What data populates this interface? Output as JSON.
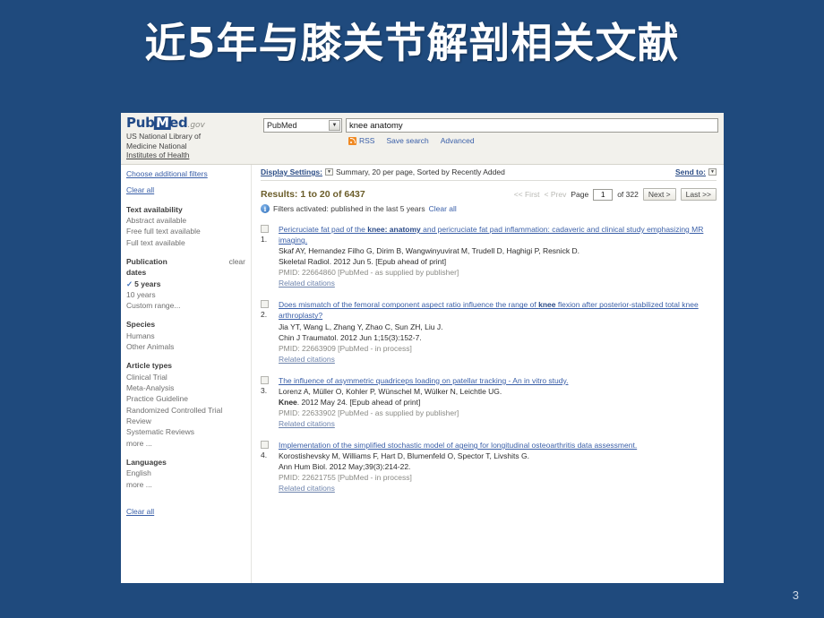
{
  "slide": {
    "title": "近5年与膝关节解剖相关文献",
    "number": "3",
    "background_color": "#1f4a7d"
  },
  "pubmed": {
    "logo": {
      "part1": "Pub",
      "part2": "M",
      "part3": "ed",
      "suffix": ".gov"
    },
    "agency_line1": "US National Library of",
    "agency_line2": "Medicine National",
    "agency_line3": "Institutes of Health",
    "choose_filters_link": "Choose additional filters",
    "search": {
      "database": "PubMed",
      "query": "knee anatomy",
      "rss_label": "RSS",
      "save_search_label": "Save search",
      "advanced_label": "Advanced"
    },
    "sidebar": {
      "clear_all_top": "Clear all",
      "clear_all_bottom": "Clear all",
      "groups": [
        {
          "heading": "Text availability",
          "clear_label": "",
          "items": [
            {
              "label": "Abstract available",
              "selected": false
            },
            {
              "label": "Free full text available",
              "selected": false
            },
            {
              "label": "Full text available",
              "selected": false
            }
          ]
        },
        {
          "heading": "Publication dates",
          "clear_label": "clear",
          "items": [
            {
              "label": "5 years",
              "selected": true
            },
            {
              "label": "10 years",
              "selected": false
            },
            {
              "label": "Custom range...",
              "selected": false
            }
          ]
        },
        {
          "heading": "Species",
          "clear_label": "",
          "items": [
            {
              "label": "Humans",
              "selected": false
            },
            {
              "label": "Other Animals",
              "selected": false
            }
          ]
        },
        {
          "heading": "Article types",
          "clear_label": "",
          "items": [
            {
              "label": "Clinical Trial",
              "selected": false
            },
            {
              "label": "Meta-Analysis",
              "selected": false
            },
            {
              "label": "Practice Guideline",
              "selected": false
            },
            {
              "label": "Randomized Controlled Trial",
              "selected": false
            },
            {
              "label": "Review",
              "selected": false
            },
            {
              "label": "Systematic Reviews",
              "selected": false
            },
            {
              "label": "more ...",
              "selected": false
            }
          ]
        },
        {
          "heading": "Languages",
          "clear_label": "",
          "items": [
            {
              "label": "English",
              "selected": false
            },
            {
              "label": "more ...",
              "selected": false
            }
          ]
        }
      ]
    },
    "display_settings": {
      "label": "Display Settings:",
      "summary": "Summary, 20 per page, Sorted by Recently Added",
      "send_to_label": "Send to:"
    },
    "results_header": {
      "count_text": "Results: 1 to 20 of 6437",
      "first_label": "<< First",
      "prev_label": "< Prev",
      "page_word": "Page",
      "page_value": "1",
      "of_text": "of 322",
      "next_label": "Next >",
      "last_label": "Last >>",
      "filters_text": "Filters activated: published in the last 5 years",
      "filters_clear_label": "Clear all"
    },
    "results": [
      {
        "number": "1.",
        "title_pre": "Pericruciate fat pad of the ",
        "title_bold": "knee: anatomy",
        "title_post": " and pericruciate fat pad inflammation: cadaveric and clinical study emphasizing MR imaging.",
        "authors": "Skaf AY, Hernandez Filho G, Dirim B, Wangwinyuvirat M, Trudell D, Haghigi P, Resnick D.",
        "journal_bold": "",
        "journal": "Skeletal Radiol. 2012 Jun 5. [Epub ahead of print]",
        "pmid": "PMID: 22664860 [PubMed - as supplied by publisher]",
        "related": "Related citations"
      },
      {
        "number": "2.",
        "title_pre": "Does mismatch of the femoral component aspect ratio influence the range of ",
        "title_bold": "knee",
        "title_post": " flexion after posterior-stabilized total knee arthroplasty?",
        "authors": "Jia YT, Wang L, Zhang Y, Zhao C, Sun ZH, Liu J.",
        "journal_bold": "",
        "journal": "Chin J Traumatol. 2012 Jun 1;15(3):152-7.",
        "pmid": "PMID: 22663909 [PubMed - in process]",
        "related": "Related citations"
      },
      {
        "number": "3.",
        "title_pre": "The influence of asymmetric quadriceps loading on patellar tracking - An in vitro study.",
        "title_bold": "",
        "title_post": "",
        "authors": "Lorenz A, Müller O, Kohler P, Wünschel M, Wülker N, Leichtle UG.",
        "journal_bold": "Knee",
        "journal": ". 2012 May 24. [Epub ahead of print]",
        "pmid": "PMID: 22633902 [PubMed - as supplied by publisher]",
        "related": "Related citations"
      },
      {
        "number": "4.",
        "title_pre": "Implementation of the simplified stochastic model of ageing for longitudinal osteoarthritis data assessment.",
        "title_bold": "",
        "title_post": "",
        "authors": "Korostishevsky M, Williams F, Hart D, Blumenfeld O, Spector T, Livshits G.",
        "journal_bold": "",
        "journal": "Ann Hum Biol. 2012 May;39(3):214-22.",
        "pmid": "PMID: 22621755 [PubMed - in process]",
        "related": "Related citations"
      }
    ]
  }
}
